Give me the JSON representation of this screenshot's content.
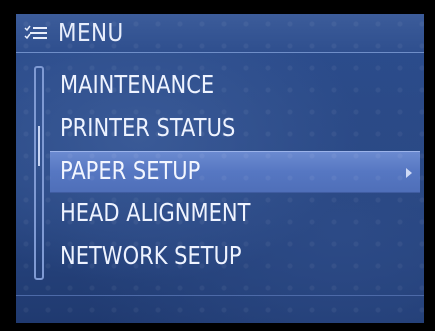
{
  "title_bar": {
    "icon": "menu-list-icon",
    "title": "MENU"
  },
  "menu": {
    "items": [
      {
        "label": "MAINTENANCE",
        "selected": false
      },
      {
        "label": "PRINTER STATUS",
        "selected": false
      },
      {
        "label": "PAPER SETUP",
        "selected": true,
        "has_submenu": true
      },
      {
        "label": "HEAD ALIGNMENT",
        "selected": false
      },
      {
        "label": "NETWORK SETUP",
        "selected": false
      }
    ]
  },
  "colors": {
    "background": "#2c4d8e",
    "highlight": "#5677c2",
    "text": "#eef3ff",
    "bezel": "#000000"
  }
}
